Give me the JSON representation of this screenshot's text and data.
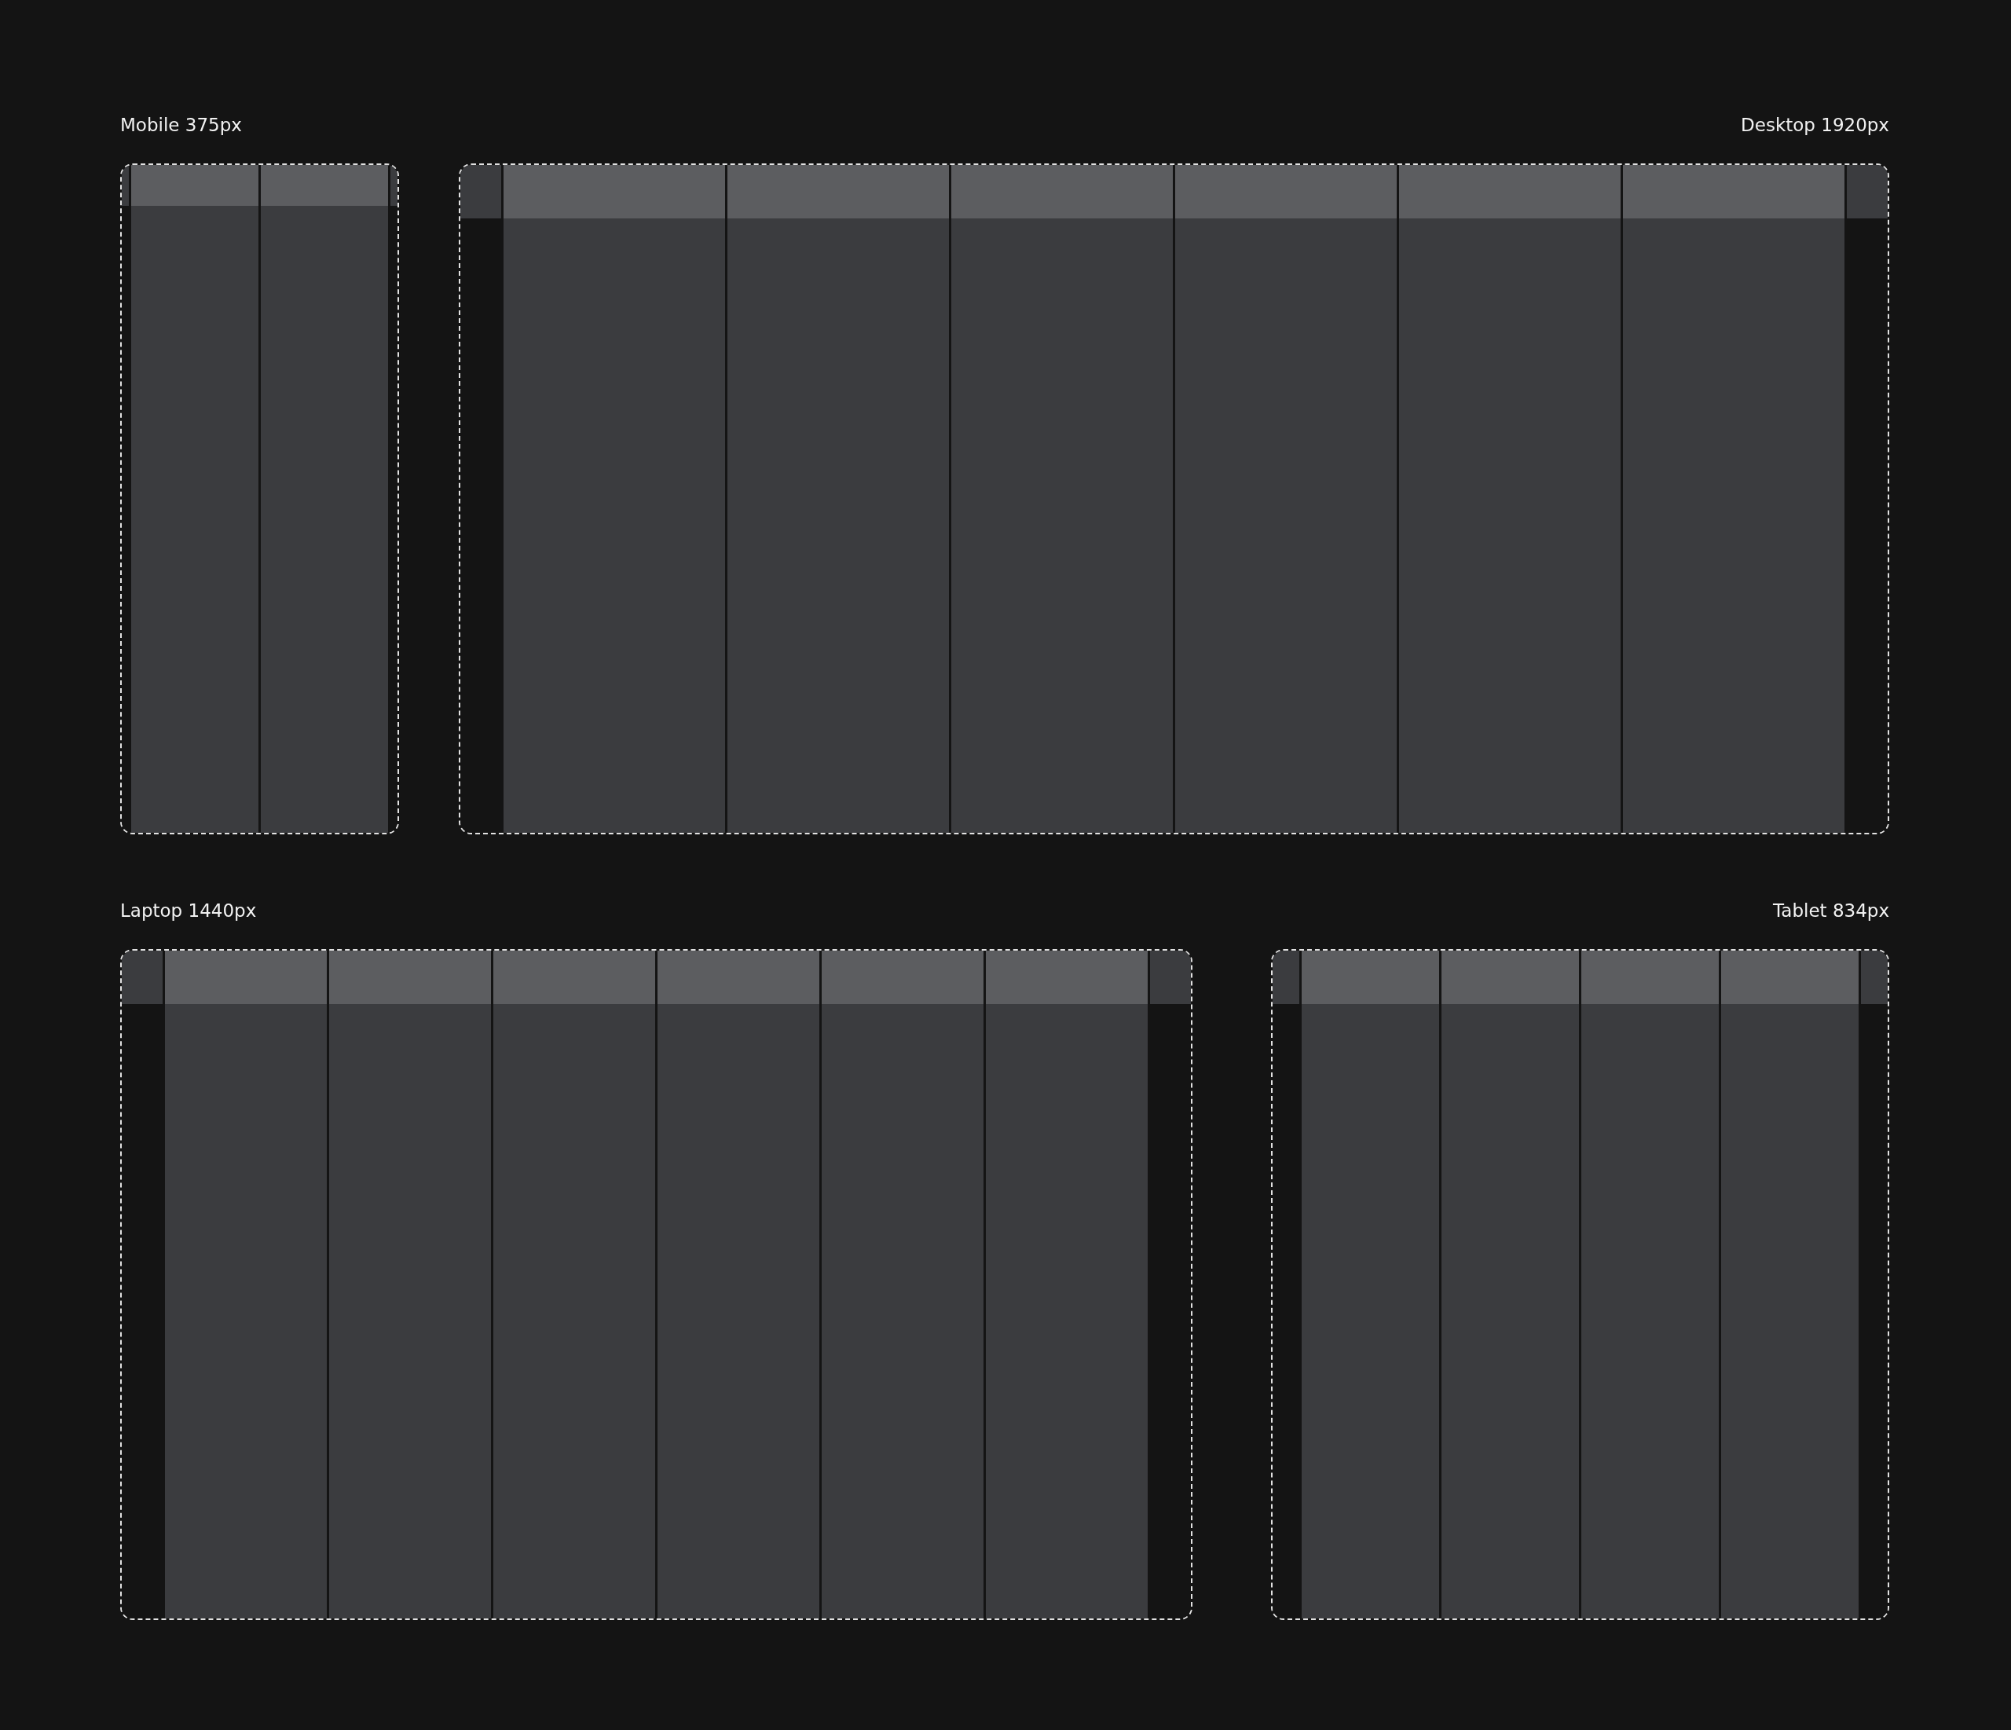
{
  "rows": [
    {
      "frames": [
        {
          "label": "Mobile 375px",
          "kind": "mobile"
        },
        {
          "label": "Desktop 1920px",
          "kind": "desktop"
        }
      ]
    },
    {
      "frames": [
        {
          "label": "Laptop 1440px",
          "kind": "laptop"
        },
        {
          "label": "Tablet 834px",
          "kind": "tablet"
        }
      ]
    }
  ]
}
